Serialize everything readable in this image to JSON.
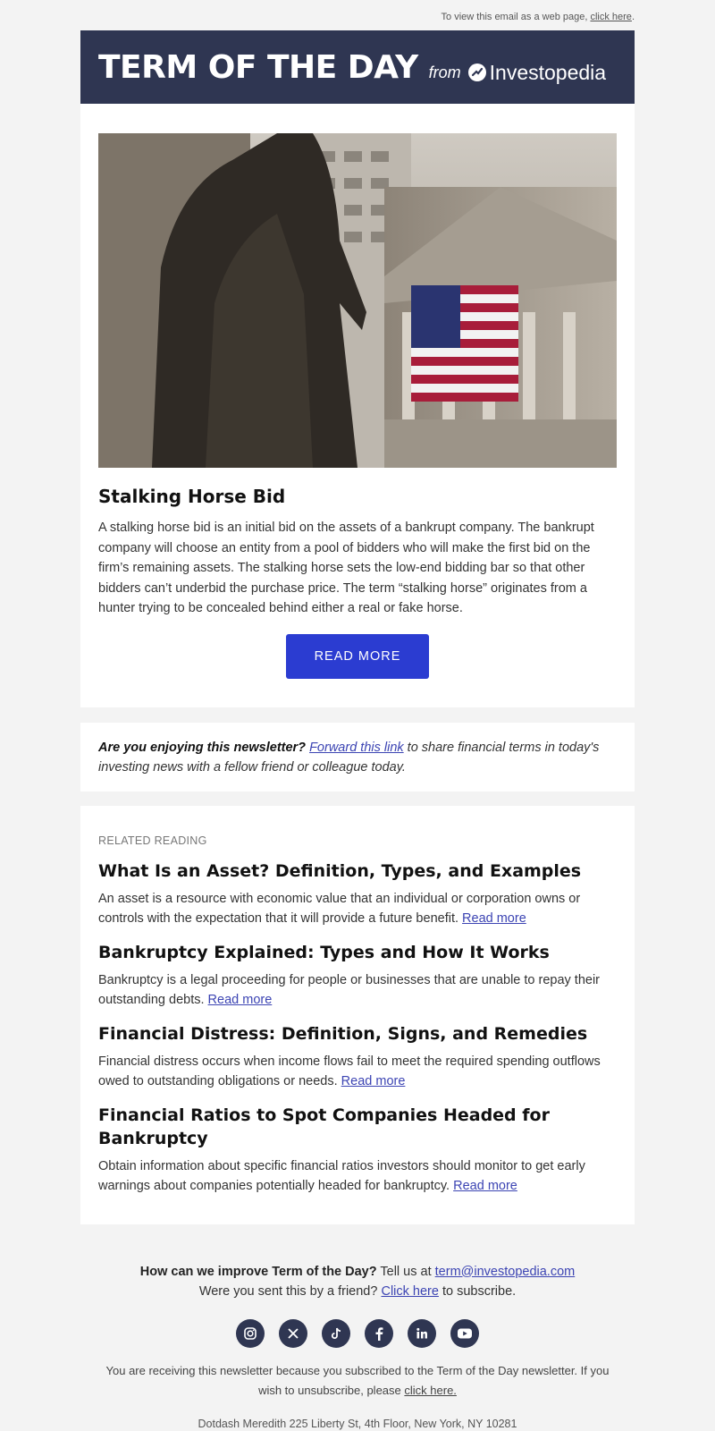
{
  "top_note": {
    "text": "To view this email as a web page,",
    "link": "click here",
    "suffix": "."
  },
  "banner": {
    "title": "TERM OF THE DAY",
    "from": "from",
    "brand": "Investopedia"
  },
  "term": {
    "title": "Stalking Horse Bid",
    "body": "A stalking horse bid is an initial bid on the assets of a bankrupt company. The bankrupt company will choose an entity from a pool of bidders who will make the first bid on the firm’s remaining assets. The stalking horse sets the low-end bidding bar so that other bidders can’t underbid the purchase price. The term “stalking horse” originates from a hunter trying to be concealed behind either a real or fake horse.",
    "button": "READ MORE"
  },
  "forward": {
    "lead": "Are you enjoying this newsletter?",
    "link": "Forward this link",
    "rest": "to share financial terms in today's investing news with a fellow friend or colleague today."
  },
  "related": {
    "heading": "RELATED READING",
    "items": [
      {
        "title": "What Is an Asset? Definition, Types, and Examples",
        "desc": "An asset is a resource with economic value that an individual or corporation owns or controls with the expectation that it will provide a future benefit.",
        "link": "Read more"
      },
      {
        "title": "Bankruptcy Explained: Types and How It Works",
        "desc": "Bankruptcy is a legal proceeding for people or businesses that are unable to repay their outstanding debts.",
        "link": "Read more"
      },
      {
        "title": "Financial Distress: Definition, Signs, and Remedies",
        "desc": "Financial distress occurs when income flows fail to meet the required spending outflows owed to outstanding obligations or needs.",
        "link": "Read more"
      },
      {
        "title": "Financial Ratios to Spot Companies Headed for Bankruptcy",
        "desc": "Obtain information about specific financial ratios investors should monitor to get early warnings about companies potentially headed for bankruptcy.",
        "link": "Read more"
      }
    ]
  },
  "footer": {
    "improve_bold": "How can we improve Term of the Day?",
    "improve_text": "Tell us at",
    "email": "term@investopedia.com",
    "friend_text": "Were you sent this by a friend?",
    "friend_link": "Click here",
    "friend_suffix": "to subscribe.",
    "social": [
      "instagram-icon",
      "x-icon",
      "tiktok-icon",
      "facebook-icon",
      "linkedin-icon",
      "youtube-icon"
    ],
    "legal": "You are receiving this newsletter because you subscribed to the Term of the Day newsletter. If you wish to unsubscribe, please",
    "unsubscribe": "click here.",
    "address": "Dotdash Meredith 225 Liberty St, 4th Floor, New York, NY 10281"
  },
  "colors": {
    "banner": "#2f3652",
    "button": "#2b3cd1",
    "link": "#3c44b3",
    "page_bg": "#f3f3f3"
  }
}
